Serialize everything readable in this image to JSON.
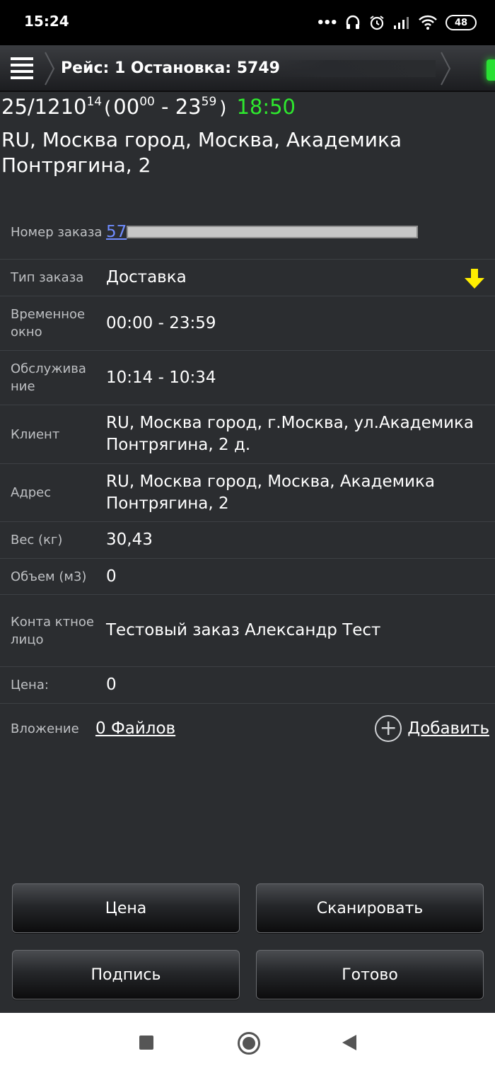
{
  "status_bar": {
    "time": "15:24",
    "dots": "•••",
    "battery": "48"
  },
  "title_bar": {
    "title": "Рейс: 1 Остановка: 5749"
  },
  "header": {
    "date": "25/12",
    "arrival_hour": "10",
    "arrival_min": "14",
    "paren_open": "(",
    "window_from_hour": "00",
    "window_from_min": "00",
    "dash": " - ",
    "window_to_hour": "23",
    "window_to_min": "59",
    "paren_close": ")",
    "clock": "18:50",
    "address": "RU, Москва город, Москва, Академика Понтрягина, 2"
  },
  "details": {
    "order_number": {
      "label": "Номер заказа",
      "value_prefix": "57"
    },
    "order_type": {
      "label": "Тип заказа",
      "value": "Доставка"
    },
    "time_window": {
      "label": "Временное окно",
      "value": "00:00 - 23:59"
    },
    "service": {
      "label": "Обслужива ние",
      "value": "10:14 - 10:34"
    },
    "client": {
      "label": "Клиент",
      "value": "RU, Москва город, г.Москва, ул.Академика Понтрягина, 2 д."
    },
    "address": {
      "label": "Адрес",
      "value": "RU, Москва город, Москва, Академика Понтрягина, 2"
    },
    "weight": {
      "label": "Вес (кг)",
      "value": "30,43"
    },
    "volume": {
      "label": "Объем (м3)",
      "value": "0"
    },
    "contact": {
      "label": "Конта ктное лицо",
      "value": "Тестовый заказ Александр Тест"
    },
    "price": {
      "label": "Цена:",
      "value": "0"
    },
    "attachment": {
      "label": "Вложение",
      "files": "0 Файлов",
      "add": "Добавить"
    }
  },
  "buttons": {
    "price": "Цена",
    "scan": "Сканировать",
    "signature": "Подпись",
    "done": "Готово"
  },
  "colors": {
    "background": "#2b2d30",
    "clock_green": "#2ee82e",
    "link_blue": "#6f8cff",
    "arrow_yellow": "#ffee00",
    "led_green": "#29e033"
  },
  "icons": {
    "menu": "menu-icon",
    "down_arrow": "arrow-down-icon",
    "add": "plus-circle-icon"
  }
}
